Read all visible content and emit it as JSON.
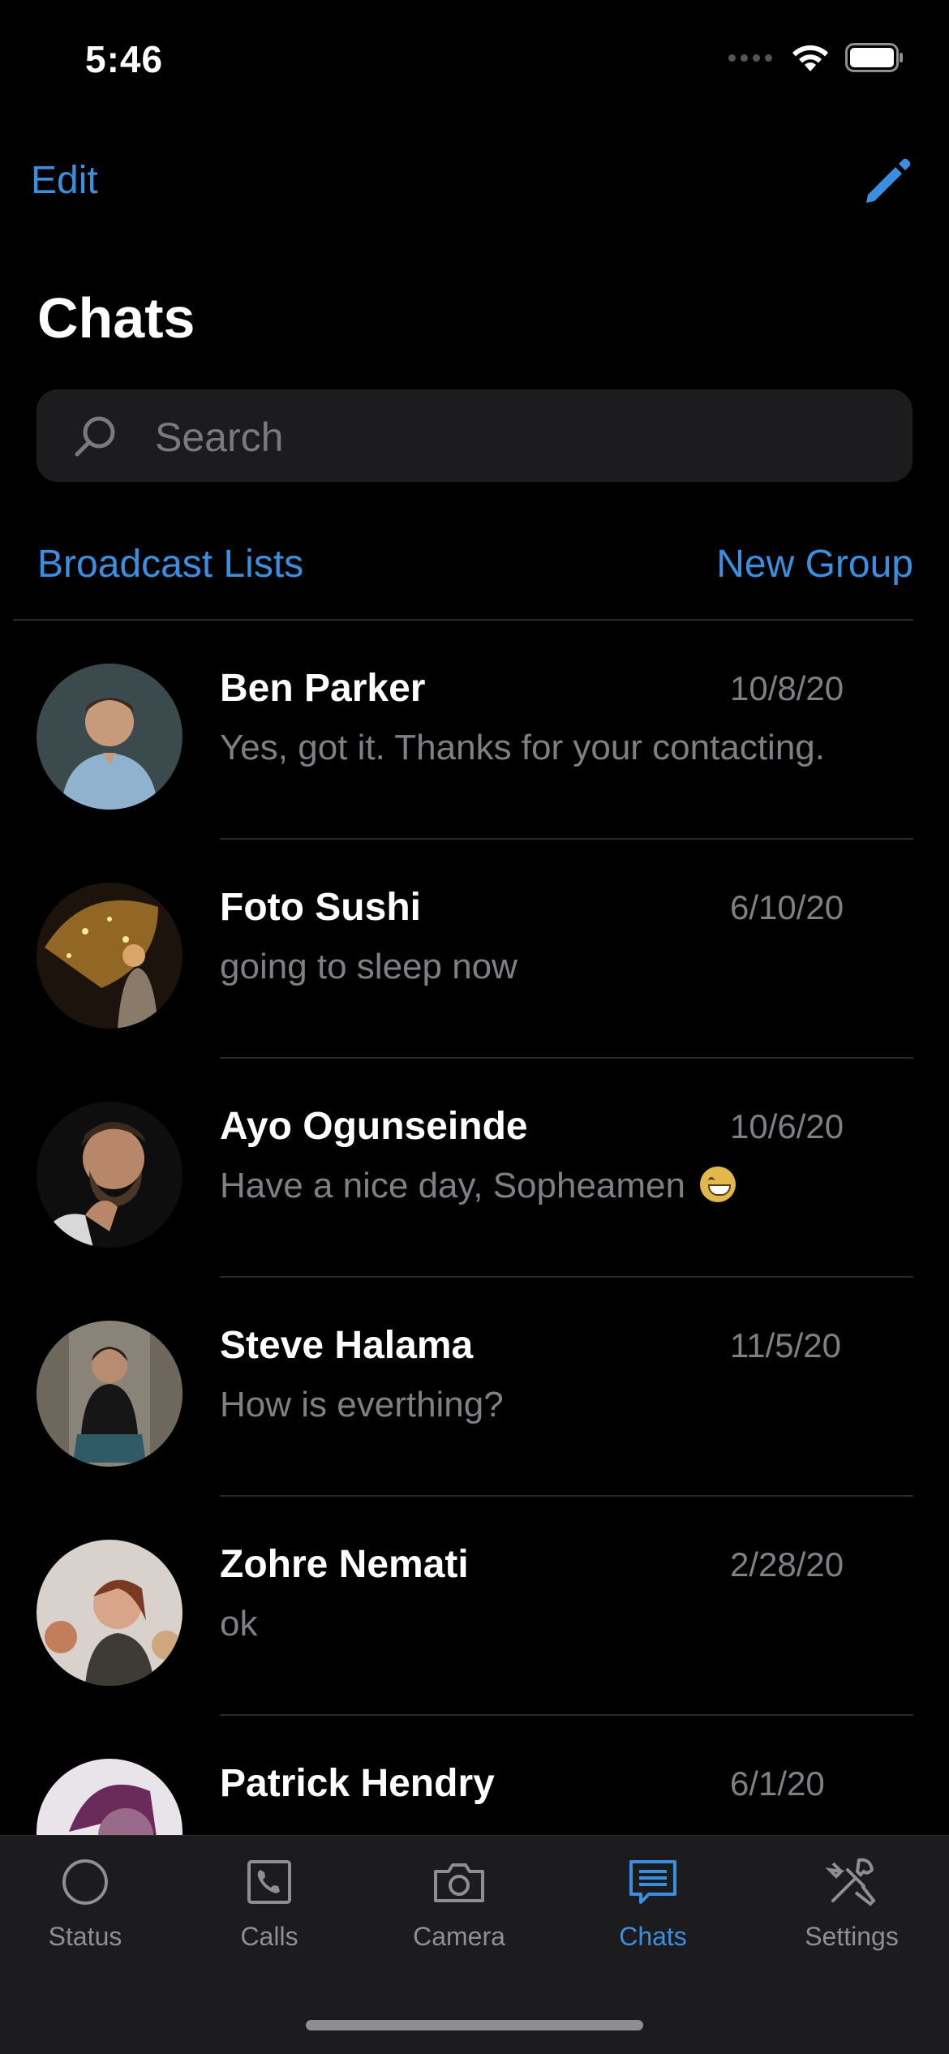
{
  "status_bar": {
    "time": "5:46"
  },
  "header": {
    "edit_label": "Edit",
    "title": "Chats"
  },
  "search": {
    "placeholder": "Search"
  },
  "links": {
    "broadcast": "Broadcast Lists",
    "new_group": "New Group"
  },
  "chats": [
    {
      "name": "Ben Parker",
      "date": "10/8/20",
      "preview": "Yes, got it. Thanks for your contacting."
    },
    {
      "name": "Foto Sushi",
      "date": "6/10/20",
      "preview": "going to sleep now"
    },
    {
      "name": "Ayo Ogunseinde",
      "date": "10/6/20",
      "preview": "Have a nice day, Sopheamen"
    },
    {
      "name": "Steve Halama",
      "date": "11/5/20",
      "preview": "How is everthing?"
    },
    {
      "name": "Zohre Nemati",
      "date": "2/28/20",
      "preview": "ok"
    },
    {
      "name": "Patrick Hendry",
      "date": "6/1/20",
      "preview": ""
    }
  ],
  "tabs": [
    {
      "label": "Status",
      "icon": "status-icon"
    },
    {
      "label": "Calls",
      "icon": "calls-icon"
    },
    {
      "label": "Camera",
      "icon": "camera-icon"
    },
    {
      "label": "Chats",
      "icon": "chats-icon",
      "active": true
    },
    {
      "label": "Settings",
      "icon": "settings-icon"
    }
  ],
  "colors": {
    "accent": "#3b8fe0",
    "background": "#000000",
    "secondary_text": "#808084"
  }
}
